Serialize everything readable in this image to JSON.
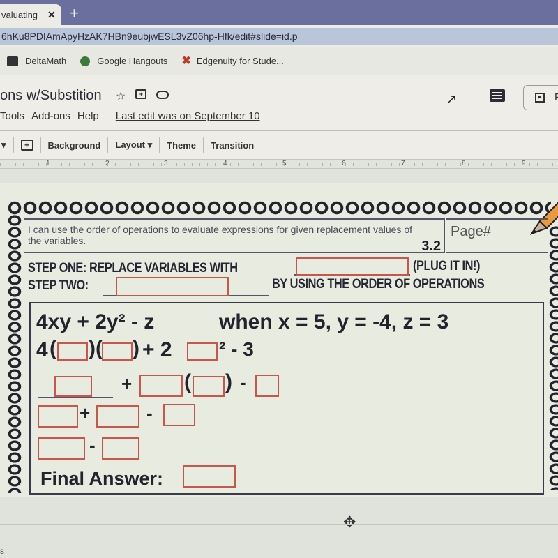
{
  "browser": {
    "tab_title": "valuating",
    "tab_close": "✕",
    "new_tab": "+",
    "url": "6hKu8PDIAmApyHzAK7HBn9eubjwESL3vZ06hp-Hfk/edit#slide=id.p",
    "bookmarks": [
      {
        "label": "DeltaMath",
        "icon": "deltamath-icon"
      },
      {
        "label": "Google Hangouts",
        "icon": "hangouts-icon"
      },
      {
        "label": "Edgenuity for Stude...",
        "icon": "edgenuity-icon"
      }
    ]
  },
  "app": {
    "doc_title": "ons w/Substition",
    "menu": [
      "Tools",
      "Add-ons",
      "Help"
    ],
    "last_edit": "Last edit was on September 10",
    "present_label": "P",
    "toolbar": {
      "background": "Background",
      "layout": "Layout ▾",
      "theme": "Theme",
      "transition": "Transition"
    },
    "ruler": [
      "1",
      "2",
      "3",
      "4",
      "5",
      "6",
      "7",
      "8",
      "9"
    ]
  },
  "slide": {
    "objective": "I can use the order of operations to evaluate expressions for given replacement values of the variables.",
    "lesson_number": "3.2",
    "page_label": "Page#",
    "step_one": "STEP ONE: REPLACE VARIABLES WITH",
    "step_one_suffix": "(PLUG IT IN!)",
    "step_two": "STEP TWO:",
    "step_two_suffix": "BY USING THE ORDER OF OPERATIONS",
    "expression": "4xy + 2y² - z",
    "given": "when x = 5, y = -4, z = 3",
    "row2": {
      "coef": "4",
      "plus_two": "+ 2",
      "sq_minus": "² - 3"
    },
    "ops": {
      "plus": "+",
      "minus": "-"
    },
    "final_answer_label": "Final Answer:",
    "accent_color": "#c9564a"
  },
  "footer": {
    "corner_text": "s"
  }
}
